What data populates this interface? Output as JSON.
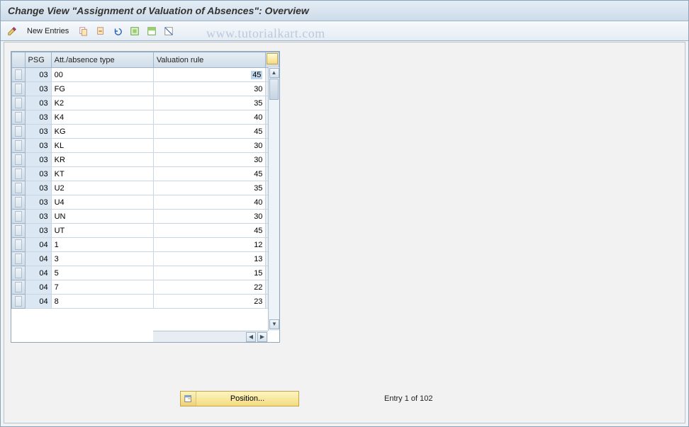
{
  "header": {
    "title": "Change View \"Assignment of Valuation of Absences\": Overview"
  },
  "toolbar": {
    "new_entries_label": "New Entries",
    "icons": {
      "edit": "edit-icon",
      "copy": "copy-icon",
      "copy_alt": "copy-alt-icon",
      "undo": "undo-icon",
      "select_all": "select-all-icon",
      "select_block": "select-block-icon",
      "deselect": "deselect-icon"
    }
  },
  "watermark": "www.tutorialkart.com",
  "table": {
    "columns": {
      "psg": "PSG",
      "type": "Att./absence type",
      "rule": "Valuation rule"
    },
    "config_button": "table-settings",
    "rows": [
      {
        "psg": "03",
        "type": "00",
        "rule": "45"
      },
      {
        "psg": "03",
        "type": "FG",
        "rule": "30"
      },
      {
        "psg": "03",
        "type": "K2",
        "rule": "35"
      },
      {
        "psg": "03",
        "type": "K4",
        "rule": "40"
      },
      {
        "psg": "03",
        "type": "KG",
        "rule": "45"
      },
      {
        "psg": "03",
        "type": "KL",
        "rule": "30"
      },
      {
        "psg": "03",
        "type": "KR",
        "rule": "30"
      },
      {
        "psg": "03",
        "type": "KT",
        "rule": "45"
      },
      {
        "psg": "03",
        "type": "U2",
        "rule": "35"
      },
      {
        "psg": "03",
        "type": "U4",
        "rule": "40"
      },
      {
        "psg": "03",
        "type": "UN",
        "rule": "30"
      },
      {
        "psg": "03",
        "type": "UT",
        "rule": "45"
      },
      {
        "psg": "04",
        "type": "1",
        "rule": "12"
      },
      {
        "psg": "04",
        "type": "3",
        "rule": "13"
      },
      {
        "psg": "04",
        "type": "5",
        "rule": "15"
      },
      {
        "psg": "04",
        "type": "7",
        "rule": "22"
      },
      {
        "psg": "04",
        "type": "8",
        "rule": "23"
      }
    ],
    "selected_cell": {
      "row": 0,
      "col": "rule"
    }
  },
  "footer": {
    "position_label": "Position...",
    "entry_text": "Entry 1 of 102"
  }
}
